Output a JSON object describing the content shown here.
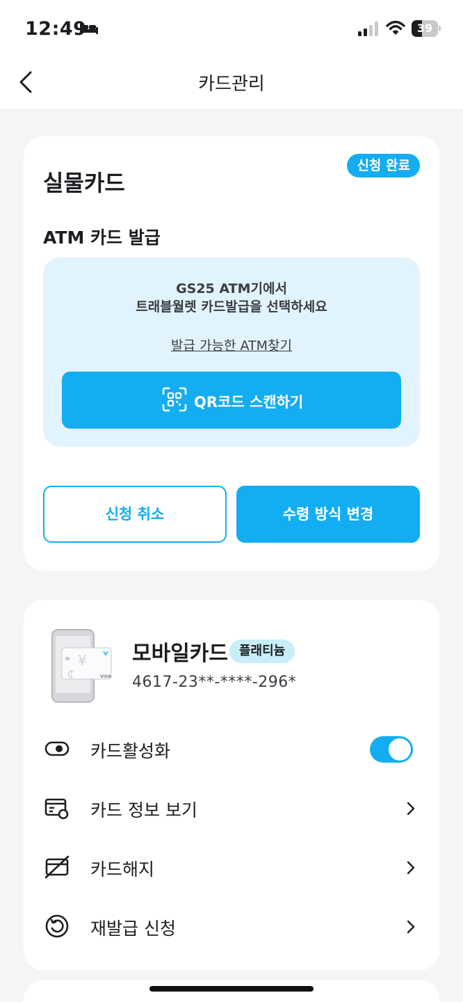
{
  "status_bar": {
    "time": "12:49",
    "battery": "39",
    "battery_level": 0.39,
    "icons": [
      "bed-icon",
      "signal-icon",
      "wifi-icon",
      "battery-icon"
    ]
  },
  "nav": {
    "title": "카드관리",
    "back_icon": "chevron-left-icon"
  },
  "physical_card": {
    "title": "실물카드",
    "status_badge": "신청 완료",
    "subtitle": "ATM 카드 발급",
    "info_line1": "GS25 ATM기에서",
    "info_line2": "트래블월렛 카드발급을 선택하세요",
    "atm_link": "발급 가능한 ATM찾기",
    "qr_button": "QR코드 스캔하기",
    "cancel_button": "신청 취소",
    "change_button": "수령 방식 변경"
  },
  "mobile_card": {
    "title": "모바일카드",
    "grade": "플래티늄",
    "card_number": "4617-23**-****-296*",
    "menu": [
      {
        "label": "카드활성화",
        "icon": "toggle-icon",
        "type": "toggle",
        "on": true
      },
      {
        "label": "카드 정보 보기",
        "icon": "card-info-icon",
        "type": "link"
      },
      {
        "label": "카드해지",
        "icon": "card-cancel-icon",
        "type": "link"
      },
      {
        "label": "재발급 신청",
        "icon": "reissue-icon",
        "type": "link"
      }
    ]
  },
  "colors": {
    "accent": "#14adf2",
    "info_box": "#e1f3fc",
    "background": "#f4f5f7",
    "grade_badge": "#c8eef8"
  }
}
